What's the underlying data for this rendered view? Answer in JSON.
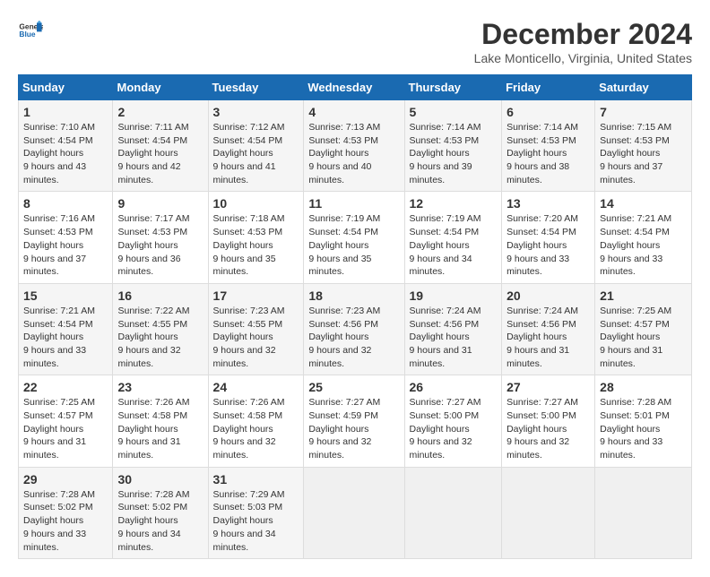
{
  "logo": {
    "line1": "General",
    "line2": "Blue"
  },
  "title": "December 2024",
  "subtitle": "Lake Monticello, Virginia, United States",
  "weekdays": [
    "Sunday",
    "Monday",
    "Tuesday",
    "Wednesday",
    "Thursday",
    "Friday",
    "Saturday"
  ],
  "weeks": [
    [
      {
        "day": "1",
        "sunrise": "7:10 AM",
        "sunset": "4:54 PM",
        "daylight": "9 hours and 43 minutes."
      },
      {
        "day": "2",
        "sunrise": "7:11 AM",
        "sunset": "4:54 PM",
        "daylight": "9 hours and 42 minutes."
      },
      {
        "day": "3",
        "sunrise": "7:12 AM",
        "sunset": "4:54 PM",
        "daylight": "9 hours and 41 minutes."
      },
      {
        "day": "4",
        "sunrise": "7:13 AM",
        "sunset": "4:53 PM",
        "daylight": "9 hours and 40 minutes."
      },
      {
        "day": "5",
        "sunrise": "7:14 AM",
        "sunset": "4:53 PM",
        "daylight": "9 hours and 39 minutes."
      },
      {
        "day": "6",
        "sunrise": "7:14 AM",
        "sunset": "4:53 PM",
        "daylight": "9 hours and 38 minutes."
      },
      {
        "day": "7",
        "sunrise": "7:15 AM",
        "sunset": "4:53 PM",
        "daylight": "9 hours and 37 minutes."
      }
    ],
    [
      {
        "day": "8",
        "sunrise": "7:16 AM",
        "sunset": "4:53 PM",
        "daylight": "9 hours and 37 minutes."
      },
      {
        "day": "9",
        "sunrise": "7:17 AM",
        "sunset": "4:53 PM",
        "daylight": "9 hours and 36 minutes."
      },
      {
        "day": "10",
        "sunrise": "7:18 AM",
        "sunset": "4:53 PM",
        "daylight": "9 hours and 35 minutes."
      },
      {
        "day": "11",
        "sunrise": "7:19 AM",
        "sunset": "4:54 PM",
        "daylight": "9 hours and 35 minutes."
      },
      {
        "day": "12",
        "sunrise": "7:19 AM",
        "sunset": "4:54 PM",
        "daylight": "9 hours and 34 minutes."
      },
      {
        "day": "13",
        "sunrise": "7:20 AM",
        "sunset": "4:54 PM",
        "daylight": "9 hours and 33 minutes."
      },
      {
        "day": "14",
        "sunrise": "7:21 AM",
        "sunset": "4:54 PM",
        "daylight": "9 hours and 33 minutes."
      }
    ],
    [
      {
        "day": "15",
        "sunrise": "7:21 AM",
        "sunset": "4:54 PM",
        "daylight": "9 hours and 33 minutes."
      },
      {
        "day": "16",
        "sunrise": "7:22 AM",
        "sunset": "4:55 PM",
        "daylight": "9 hours and 32 minutes."
      },
      {
        "day": "17",
        "sunrise": "7:23 AM",
        "sunset": "4:55 PM",
        "daylight": "9 hours and 32 minutes."
      },
      {
        "day": "18",
        "sunrise": "7:23 AM",
        "sunset": "4:56 PM",
        "daylight": "9 hours and 32 minutes."
      },
      {
        "day": "19",
        "sunrise": "7:24 AM",
        "sunset": "4:56 PM",
        "daylight": "9 hours and 31 minutes."
      },
      {
        "day": "20",
        "sunrise": "7:24 AM",
        "sunset": "4:56 PM",
        "daylight": "9 hours and 31 minutes."
      },
      {
        "day": "21",
        "sunrise": "7:25 AM",
        "sunset": "4:57 PM",
        "daylight": "9 hours and 31 minutes."
      }
    ],
    [
      {
        "day": "22",
        "sunrise": "7:25 AM",
        "sunset": "4:57 PM",
        "daylight": "9 hours and 31 minutes."
      },
      {
        "day": "23",
        "sunrise": "7:26 AM",
        "sunset": "4:58 PM",
        "daylight": "9 hours and 31 minutes."
      },
      {
        "day": "24",
        "sunrise": "7:26 AM",
        "sunset": "4:58 PM",
        "daylight": "9 hours and 32 minutes."
      },
      {
        "day": "25",
        "sunrise": "7:27 AM",
        "sunset": "4:59 PM",
        "daylight": "9 hours and 32 minutes."
      },
      {
        "day": "26",
        "sunrise": "7:27 AM",
        "sunset": "5:00 PM",
        "daylight": "9 hours and 32 minutes."
      },
      {
        "day": "27",
        "sunrise": "7:27 AM",
        "sunset": "5:00 PM",
        "daylight": "9 hours and 32 minutes."
      },
      {
        "day": "28",
        "sunrise": "7:28 AM",
        "sunset": "5:01 PM",
        "daylight": "9 hours and 33 minutes."
      }
    ],
    [
      {
        "day": "29",
        "sunrise": "7:28 AM",
        "sunset": "5:02 PM",
        "daylight": "9 hours and 33 minutes."
      },
      {
        "day": "30",
        "sunrise": "7:28 AM",
        "sunset": "5:02 PM",
        "daylight": "9 hours and 34 minutes."
      },
      {
        "day": "31",
        "sunrise": "7:29 AM",
        "sunset": "5:03 PM",
        "daylight": "9 hours and 34 minutes."
      },
      null,
      null,
      null,
      null
    ]
  ]
}
